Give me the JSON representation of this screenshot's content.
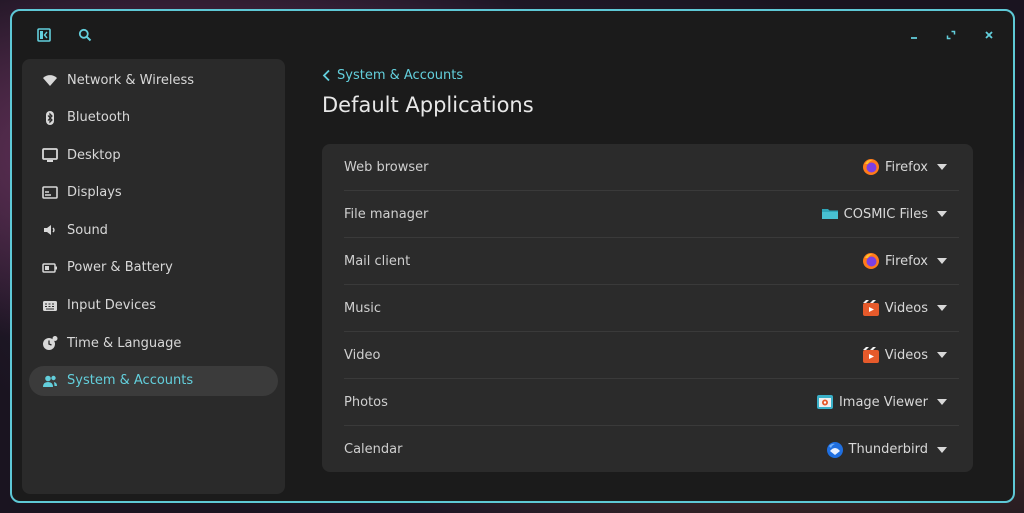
{
  "header": {
    "sidebar_toggle_icon": "sidebar-toggle-icon",
    "search_icon": "search-icon",
    "minimize_icon": "minimize-icon",
    "maximize_icon": "maximize-icon",
    "close_icon": "close-icon"
  },
  "sidebar": {
    "items": [
      {
        "label": "Network & Wireless",
        "icon": "wifi-icon"
      },
      {
        "label": "Bluetooth",
        "icon": "bluetooth-icon"
      },
      {
        "label": "Desktop",
        "icon": "desktop-icon"
      },
      {
        "label": "Displays",
        "icon": "display-icon"
      },
      {
        "label": "Sound",
        "icon": "speaker-icon"
      },
      {
        "label": "Power & Battery",
        "icon": "battery-icon"
      },
      {
        "label": "Input Devices",
        "icon": "keyboard-icon"
      },
      {
        "label": "Time & Language",
        "icon": "clock-globe-icon"
      },
      {
        "label": "System & Accounts",
        "icon": "users-icon",
        "active": true
      }
    ]
  },
  "main": {
    "back_label": "System & Accounts",
    "title": "Default Applications",
    "rows": [
      {
        "label": "Web browser",
        "app": "Firefox",
        "icon": "firefox-icon"
      },
      {
        "label": "File manager",
        "app": "COSMIC Files",
        "icon": "folder-icon"
      },
      {
        "label": "Mail client",
        "app": "Firefox",
        "icon": "firefox-icon"
      },
      {
        "label": "Music",
        "app": "Videos",
        "icon": "videos-icon"
      },
      {
        "label": "Video",
        "app": "Videos",
        "icon": "videos-icon"
      },
      {
        "label": "Photos",
        "app": "Image Viewer",
        "icon": "image-viewer-icon"
      },
      {
        "label": "Calendar",
        "app": "Thunderbird",
        "icon": "thunderbird-icon"
      }
    ]
  },
  "colors": {
    "accent": "#63cfdc",
    "window_border": "#5ec8d6",
    "window_bg": "#1b1b1b",
    "panel_bg": "#2a2a2a"
  }
}
